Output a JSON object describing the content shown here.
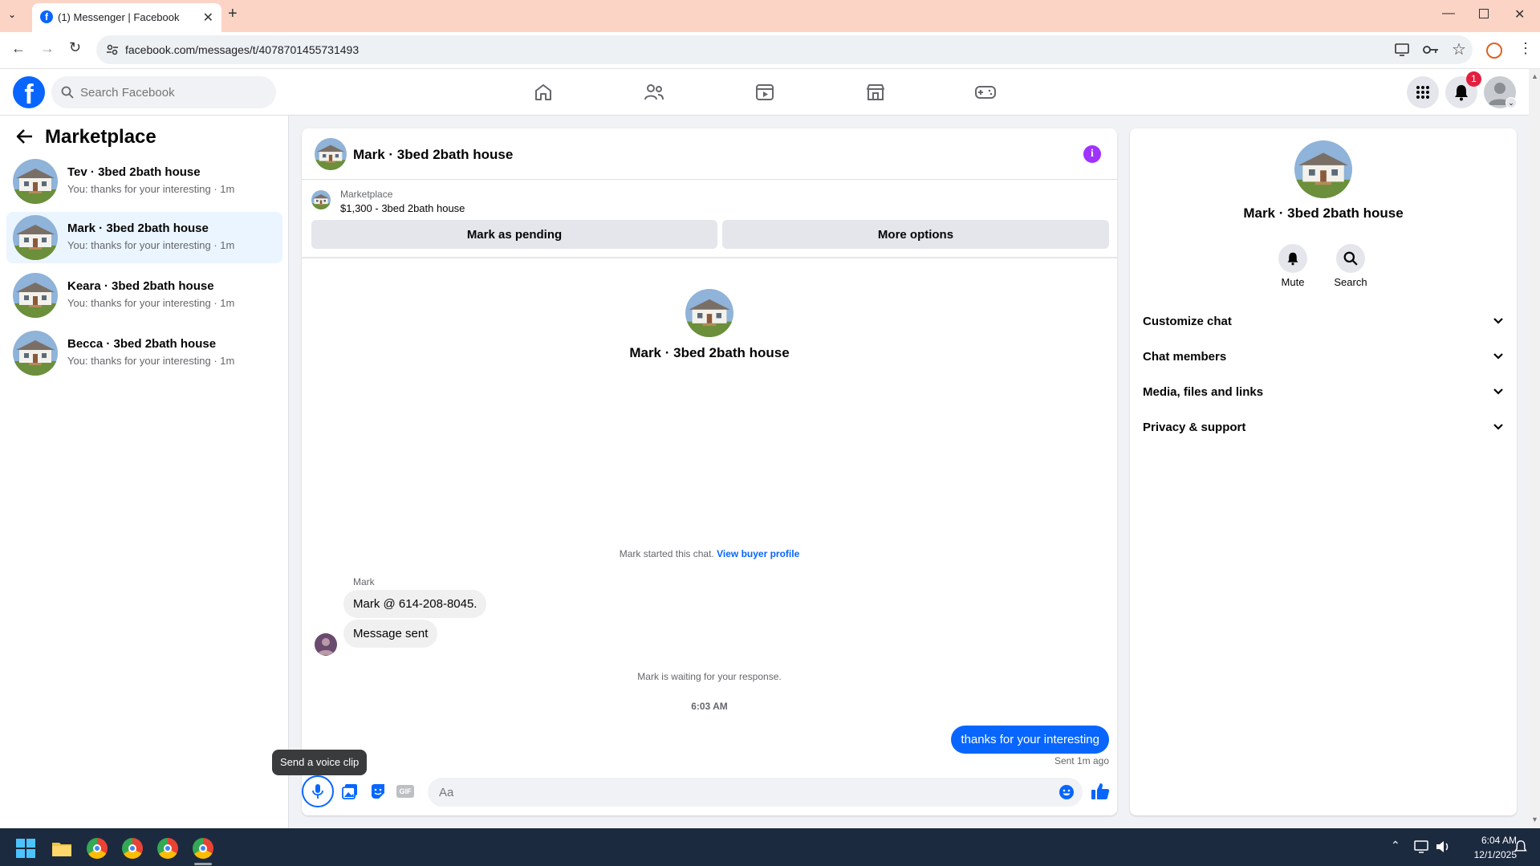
{
  "browser": {
    "tab_title": "(1) Messenger | Facebook",
    "url": "facebook.com/messages/t/4078701455731493"
  },
  "header": {
    "search_placeholder": "Search Facebook",
    "notification_count": "1"
  },
  "sidebar": {
    "title": "Marketplace",
    "conversations": [
      {
        "name": "Tev · 3bed 2bath house",
        "preview": "You: thanks for your interesting · 1m"
      },
      {
        "name": "Mark · 3bed 2bath house",
        "preview": "You: thanks for your interesting · 1m"
      },
      {
        "name": "Keara · 3bed 2bath house",
        "preview": "You: thanks for your interesting · 1m"
      },
      {
        "name": "Becca · 3bed 2bath house",
        "preview": "You: thanks for your interesting · 1m"
      }
    ]
  },
  "chat": {
    "title": "Mark · 3bed 2bath house",
    "listing_source": "Marketplace",
    "listing_summary": "$1,300 - 3bed 2bath house",
    "mark_pending_label": "Mark as pending",
    "more_options_label": "More options",
    "intro_name": "Mark · 3bed 2bath house",
    "started_text": "Mark started this chat.",
    "view_buyer_link": "View buyer profile",
    "sender_name": "Mark",
    "messages_in": [
      "Mark @ 614-208-8045.",
      "Message sent"
    ],
    "waiting_text": "Mark is waiting for your response.",
    "timestamp": "6:03 AM",
    "message_out": "thanks for your interesting",
    "sent_status": "Sent 1m ago",
    "tooltip": "Send a voice clip",
    "composer_placeholder": "Aa"
  },
  "details": {
    "name": "Mark · 3bed 2bath house",
    "mute_label": "Mute",
    "search_label": "Search",
    "sections": [
      "Customize chat",
      "Chat members",
      "Media, files and links",
      "Privacy & support"
    ]
  },
  "taskbar": {
    "time": "6:04 AM",
    "date": "12/1/2025"
  },
  "colors": {
    "accent": "#0866ff",
    "info_purple": "#a033ff",
    "badge_red": "#e41e3f",
    "tab_bar": "#fbd4c6"
  }
}
